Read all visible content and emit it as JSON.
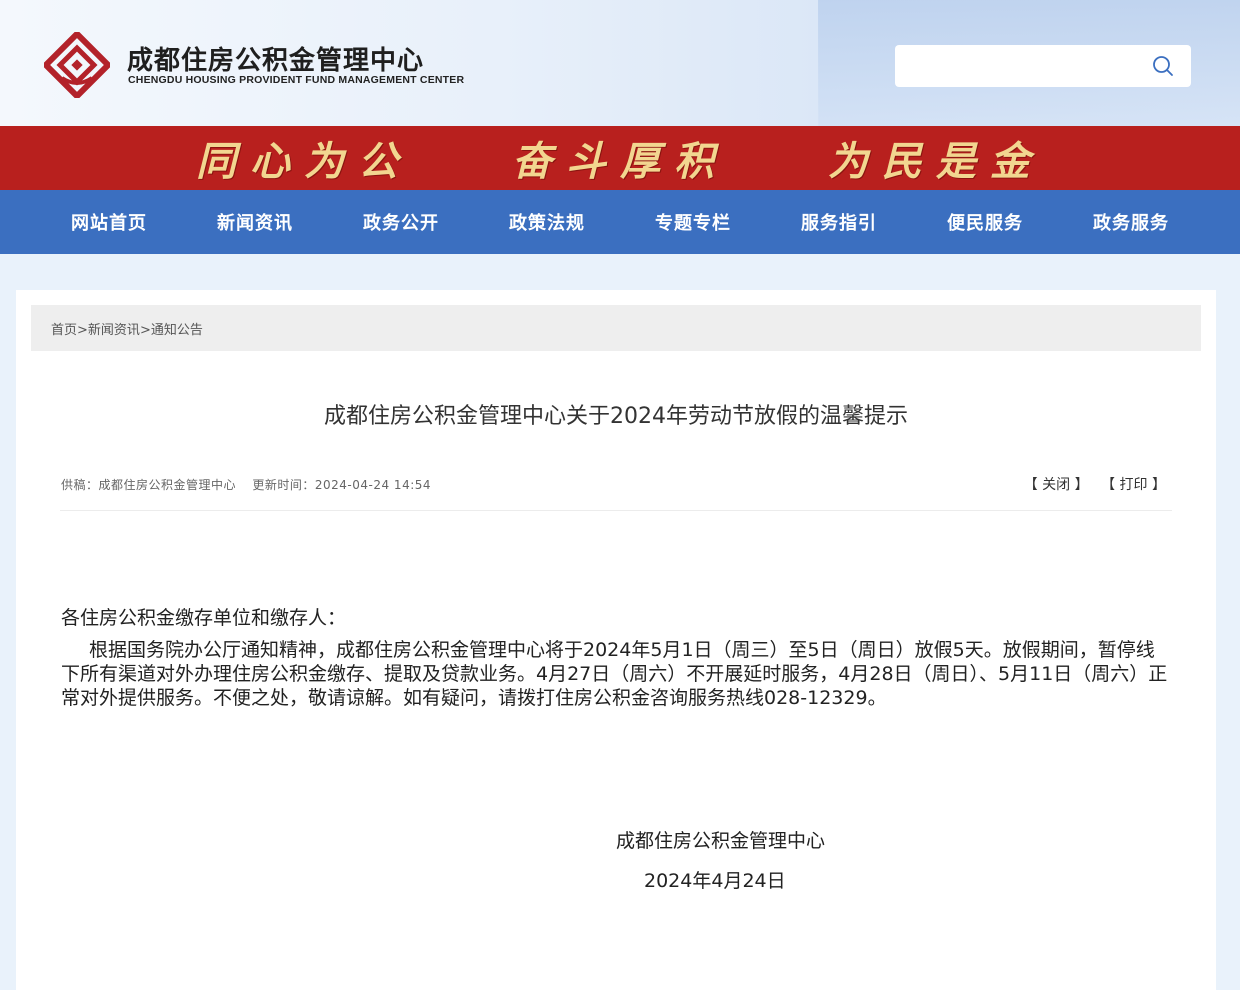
{
  "header": {
    "title": "成都住房公积金管理中心",
    "subtitle": "CHENGDU HOUSING PROVIDENT FUND MANAGEMENT CENTER",
    "search_placeholder": ""
  },
  "slogan": [
    "同心为公",
    "奋斗厚积",
    "为民是金"
  ],
  "nav": [
    "网站首页",
    "新闻资讯",
    "政务公开",
    "政策法规",
    "专题专栏",
    "服务指引",
    "便民服务",
    "政务服务"
  ],
  "breadcrumb": {
    "home": "首页",
    "sep": ">",
    "section": "新闻资讯",
    "page": "通知公告"
  },
  "article": {
    "title": "成都住房公积金管理中心关于2024年劳动节放假的温馨提示",
    "source_label": "供稿：",
    "source": "成都住房公积金管理中心",
    "updated_label": "更新时间：",
    "updated": "2024-04-24 14:54",
    "close_label": "【 关闭 】",
    "print_label": "【 打印 】",
    "salutation": "各住房公积金缴存单位和缴存人：",
    "paragraph": "根据国务院办公厅通知精神，成都住房公积金管理中心将于2024年5月1日（周三）至5日（周日）放假5天。放假期间，暂停线下所有渠道对外办理住房公积金缴存、提取及贷款业务。4月27日（周六）不开展延时服务，4月28日（周日）、5月11日（周六）正常对外提供服务。不便之处，敬请谅解。如有疑问，请拨打住房公积金咨询服务热线028-12329。",
    "sign_org": "成都住房公积金管理中心",
    "sign_date": "2024年4月24日"
  },
  "colors": {
    "slogan_bg": "#b8201e",
    "slogan_text": "#f2d690",
    "nav_bg": "#3b6fc0",
    "logo_red": "#b3222a"
  }
}
